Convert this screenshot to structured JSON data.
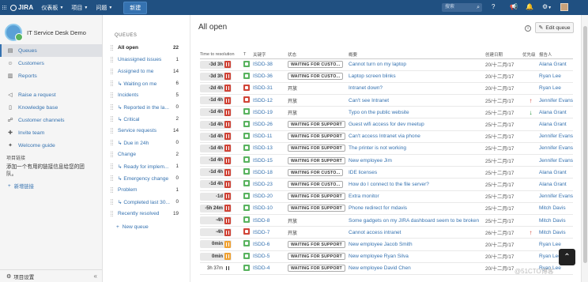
{
  "topbar": {
    "logo_text": "JIRA",
    "menus": [
      "仪表板",
      "项目",
      "问题"
    ],
    "create_label": "新建",
    "search_placeholder": "搜索",
    "avatar": "user-avatar"
  },
  "sidebar": {
    "project_name": "IT Service Desk Demo",
    "nav": [
      {
        "label": "Queues",
        "icon": "queues-icon",
        "active": true
      },
      {
        "label": "Customers",
        "icon": "customers-icon"
      },
      {
        "label": "Reports",
        "icon": "reports-icon"
      }
    ],
    "nav2": [
      {
        "label": "Raise a request",
        "icon": "megaphone-icon"
      },
      {
        "label": "Knowledge base",
        "icon": "book-icon"
      },
      {
        "label": "Customer channels",
        "icon": "channels-icon"
      },
      {
        "label": "Invite team",
        "icon": "invite-icon"
      },
      {
        "label": "Welcome guide",
        "icon": "lightbulb-icon"
      }
    ],
    "section_title": "项目链接",
    "section_desc": "添加一个有用的链接信息给您的团队。",
    "add_link_label": "新增链接",
    "settings_label": "项目设置"
  },
  "queues": {
    "title": "QUEUES",
    "items": [
      {
        "label": "All open",
        "count": "22",
        "active": true
      },
      {
        "label": "Unassigned issues",
        "count": "1"
      },
      {
        "label": "Assigned to me",
        "count": "14"
      },
      {
        "label": "↳ Waiting on me",
        "count": "6"
      },
      {
        "label": "Incidents",
        "count": "5"
      },
      {
        "label": "↳ Reported in the la...",
        "count": "0"
      },
      {
        "label": "↳ Critical",
        "count": "2"
      },
      {
        "label": "Service requests",
        "count": "14"
      },
      {
        "label": "↳ Due in 24h",
        "count": "0"
      },
      {
        "label": "Change",
        "count": "2"
      },
      {
        "label": "↳ Ready for implem...",
        "count": "1"
      },
      {
        "label": "↳ Emergency change",
        "count": "0"
      },
      {
        "label": "Problem",
        "count": "1"
      },
      {
        "label": "↳ Completed last 30...",
        "count": "0"
      },
      {
        "label": "Recently resolved",
        "count": "19"
      }
    ],
    "new_queue_label": "New queue"
  },
  "main": {
    "title": "All open",
    "edit_label": "Edit queue",
    "columns": {
      "ttr": "Time to resolution",
      "t": "T",
      "key": "关键字",
      "status": "状态",
      "summary": "概要",
      "created": "创建日期",
      "priority": "优先级",
      "reporter": "报告人"
    },
    "rows": [
      {
        "sla": "-3d 3h",
        "pause": "red",
        "type": "green",
        "key": "ISDD-38",
        "status": "WAITING FOR CUSTO...",
        "status_style": "box",
        "summary": "Cannot turn on my laptop",
        "created": "20/十二月/17",
        "priority": "",
        "reporter": "Alana Grant"
      },
      {
        "sla": "-3d 3h",
        "pause": "red",
        "type": "green",
        "key": "ISDD-36",
        "status": "WAITING FOR CUSTO...",
        "status_style": "box",
        "summary": "Laptop screen blinks",
        "created": "20/十二月/17",
        "priority": "",
        "reporter": "Ryan Lee"
      },
      {
        "sla": "-2d 4h",
        "pause": "red",
        "type": "red",
        "key": "ISDD-31",
        "status": "开放",
        "status_style": "plain",
        "summary": "Intranet down?",
        "created": "20/十二月/17",
        "priority": "",
        "reporter": "Ryan Lee"
      },
      {
        "sla": "-1d 4h",
        "pause": "red",
        "type": "red",
        "key": "ISDD-12",
        "status": "开放",
        "status_style": "plain",
        "summary": "Can't see Intranet",
        "created": "25/十二月/17",
        "priority": "up",
        "reporter": "Jennifer Evans"
      },
      {
        "sla": "-1d 4h",
        "pause": "red",
        "type": "green",
        "key": "ISDD-19",
        "status": "开放",
        "status_style": "plain",
        "summary": "Typo on the public website",
        "created": "25/十二月/17",
        "priority": "down",
        "reporter": "Alana Grant"
      },
      {
        "sla": "-1d 4h",
        "pause": "red",
        "type": "green",
        "key": "ISDD-26",
        "status": "WAITING FOR SUPPORT",
        "status_style": "box",
        "summary": "Guest wifi access for dev meetup",
        "created": "25/十二月/17",
        "priority": "",
        "reporter": "Alana Grant"
      },
      {
        "sla": "-1d 4h",
        "pause": "red",
        "type": "green",
        "key": "ISDD-11",
        "status": "WAITING FOR SUPPORT",
        "status_style": "box",
        "summary": "Can't access Intranet via phone",
        "created": "25/十二月/17",
        "priority": "",
        "reporter": "Jennifer Evans"
      },
      {
        "sla": "-1d 4h",
        "pause": "red",
        "type": "green",
        "key": "ISDD-13",
        "status": "WAITING FOR SUPPORT",
        "status_style": "box",
        "summary": "The printer is not working",
        "created": "25/十二月/17",
        "priority": "",
        "reporter": "Jennifer Evans"
      },
      {
        "sla": "-1d 4h",
        "pause": "red",
        "type": "green",
        "key": "ISDD-15",
        "status": "WAITING FOR SUPPORT",
        "status_style": "box",
        "summary": "New employee Jim",
        "created": "25/十二月/17",
        "priority": "",
        "reporter": "Jennifer Evans"
      },
      {
        "sla": "-1d 4h",
        "pause": "red",
        "type": "green",
        "key": "ISDD-18",
        "status": "WAITING FOR CUSTO...",
        "status_style": "box",
        "summary": "IDE licenses",
        "created": "25/十二月/17",
        "priority": "",
        "reporter": "Alana Grant"
      },
      {
        "sla": "-1d 4h",
        "pause": "red",
        "type": "green",
        "key": "ISDD-23",
        "status": "WAITING FOR CUSTO...",
        "status_style": "box",
        "summary": "How do I connect to the file server?",
        "created": "25/十二月/17",
        "priority": "",
        "reporter": "Alana Grant"
      },
      {
        "sla": "-1d",
        "pause": "red",
        "type": "green",
        "key": "ISDD-20",
        "status": "WAITING FOR SUPPORT",
        "status_style": "box",
        "summary": "Extra monitor",
        "created": "25/十二月/17",
        "priority": "",
        "reporter": "Jennifer Evans"
      },
      {
        "sla": "-5h 24m",
        "pause": "red",
        "type": "green",
        "key": "ISDD-10",
        "status": "WAITING FOR SUPPORT",
        "status_style": "box",
        "summary": "Phone redirect for mdavis",
        "created": "25/十二月/17",
        "priority": "",
        "reporter": "Mitch Davis"
      },
      {
        "sla": "-4h",
        "pause": "red",
        "type": "green",
        "key": "ISDD-8",
        "status": "开放",
        "status_style": "plain",
        "summary": "Some gadgets on my JIRA dashboard seem to be broken",
        "created": "25/十二月/17",
        "priority": "",
        "reporter": "Mitch Davis"
      },
      {
        "sla": "-4h",
        "pause": "red",
        "type": "red",
        "key": "ISDD-7",
        "status": "开放",
        "status_style": "plain",
        "summary": "Cannot access intranet",
        "created": "26/十二月/17",
        "priority": "up",
        "reporter": "Mitch Davis"
      },
      {
        "sla": "0min",
        "pause": "orange",
        "type": "green",
        "key": "ISDD-6",
        "status": "WAITING FOR SUPPORT",
        "status_style": "box",
        "summary": "New employee Jacob Smith",
        "created": "20/十二月/17",
        "priority": "",
        "reporter": "Ryan Lee"
      },
      {
        "sla": "0min",
        "pause": "orange",
        "type": "green",
        "key": "ISDD-5",
        "status": "WAITING FOR SUPPORT",
        "status_style": "box",
        "summary": "New employee Ryan Silva",
        "created": "20/十二月/17",
        "priority": "",
        "reporter": "Ryan Lee"
      },
      {
        "sla": "3h 37m",
        "pause": "dark",
        "type": "green",
        "key": "ISDD-4",
        "status": "WAITING FOR SUPPORT",
        "status_style": "box",
        "summary": "New employee David Chen",
        "created": "20/十二月/17",
        "priority": "",
        "reporter": "Ryan Lee"
      }
    ]
  },
  "watermark": "@51CTO博客"
}
